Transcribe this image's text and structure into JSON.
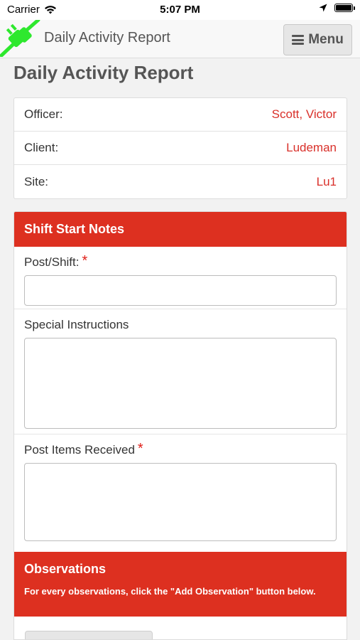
{
  "status_bar": {
    "carrier": "Carrier",
    "time": "5:07 PM",
    "wifi_icon": "wifi-icon",
    "location_icon": "location-arrow-icon",
    "battery_icon": "battery-full-icon"
  },
  "navbar": {
    "logo_icon": "green-plug-icon",
    "title": "Daily Activity Report",
    "menu_label": "Menu",
    "menu_icon": "hamburger-icon"
  },
  "page": {
    "title": "Daily Activity Report"
  },
  "info": {
    "rows": [
      {
        "label": "Officer:",
        "value": "Scott, Victor"
      },
      {
        "label": "Client:",
        "value": "Ludeman"
      },
      {
        "label": "Site:",
        "value": "Lu1"
      }
    ]
  },
  "shift_start": {
    "header": "Shift Start Notes",
    "post_shift": {
      "label": "Post/Shift:",
      "required": "*",
      "value": ""
    },
    "special_instructions": {
      "label": "Special Instructions",
      "value": ""
    },
    "post_items": {
      "label": "Post Items Received",
      "required": "*",
      "value": ""
    }
  },
  "observations": {
    "header": "Observations",
    "description": "For every observations, click the \"Add Observation\" button below."
  },
  "colors": {
    "accent": "#dd3020",
    "value_text": "#d9302a",
    "logo_green": "#2ee82e"
  }
}
